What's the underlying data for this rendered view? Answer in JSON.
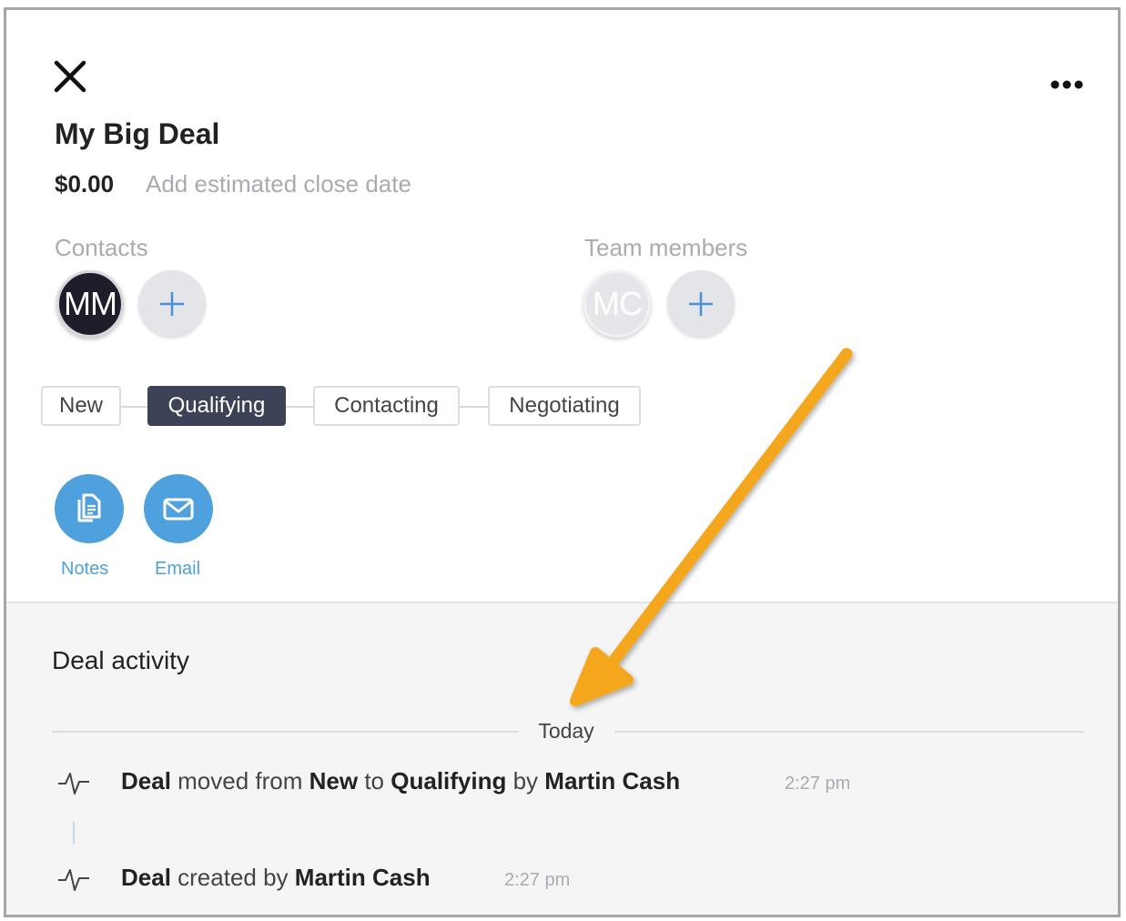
{
  "deal": {
    "title": "My Big Deal",
    "amount": "$0.00",
    "close_date_placeholder": "Add estimated close date"
  },
  "contacts": {
    "label": "Contacts",
    "avatars": [
      {
        "initials": "MM"
      }
    ]
  },
  "team": {
    "label": "Team members",
    "avatars": [
      {
        "initials": "MC"
      }
    ]
  },
  "stages": [
    {
      "label": "New",
      "active": false
    },
    {
      "label": "Qualifying",
      "active": true
    },
    {
      "label": "Contacting",
      "active": false
    },
    {
      "label": "Negotiating",
      "active": false
    }
  ],
  "actions": {
    "notes_label": "Notes",
    "email_label": "Email"
  },
  "activity": {
    "title": "Deal activity",
    "day_label": "Today",
    "items": [
      {
        "parts": {
          "w1": "Deal",
          "t1": " moved from ",
          "w2": "New",
          "t2": " to ",
          "w3": "Qualifying",
          "t3": " by ",
          "w4": "Martin Cash"
        },
        "time": "2:27 pm"
      },
      {
        "parts": {
          "w1": "Deal",
          "t1": " created by ",
          "w2": "Martin Cash"
        },
        "time": "2:27 pm"
      }
    ]
  },
  "colors": {
    "accent": "#4ea1dd",
    "active_stage": "#3d4256",
    "annotation_arrow": "#f4a61d"
  }
}
